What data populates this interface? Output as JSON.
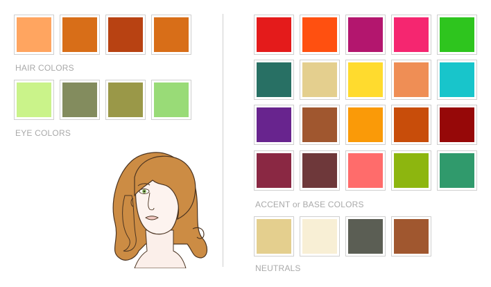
{
  "hair": {
    "label": "HAIR COLORS",
    "swatches": [
      "#FFA560",
      "#D86E18",
      "#B84212",
      "#D86E18"
    ]
  },
  "eye": {
    "label": "EYE COLORS",
    "swatches": [
      "#CAF38A",
      "#838C5E",
      "#9A9848",
      "#99DB77"
    ]
  },
  "accent": {
    "label": "ACCENT or BASE COLORS",
    "rows": [
      [
        "#E41B1B",
        "#FF5010",
        "#B3166E",
        "#F52670",
        "#2EC51E"
      ],
      [
        "#287064",
        "#E4CF8E",
        "#FFDB2E",
        "#EF8E55",
        "#18C5CB"
      ],
      [
        "#68248E",
        "#A0572F",
        "#FA9A08",
        "#C84D0A",
        "#960808"
      ],
      [
        "#8A2843",
        "#6E383A",
        "#FF6C6B",
        "#8DB60F",
        "#309A6C"
      ]
    ]
  },
  "neutrals": {
    "label": "NEUTRALS",
    "swatches": [
      "#E4CF8E",
      "#F8EFD5",
      "#5B5E54",
      "#A0572F"
    ]
  },
  "colors": {
    "label_text": "#A9A9A9",
    "swatch_border": "#CFCFCF",
    "hair_illustration": "#CC8C44",
    "eye_illustration": "#7AA84F"
  },
  "icons": {
    "portrait": "woman-portrait-illustration"
  }
}
